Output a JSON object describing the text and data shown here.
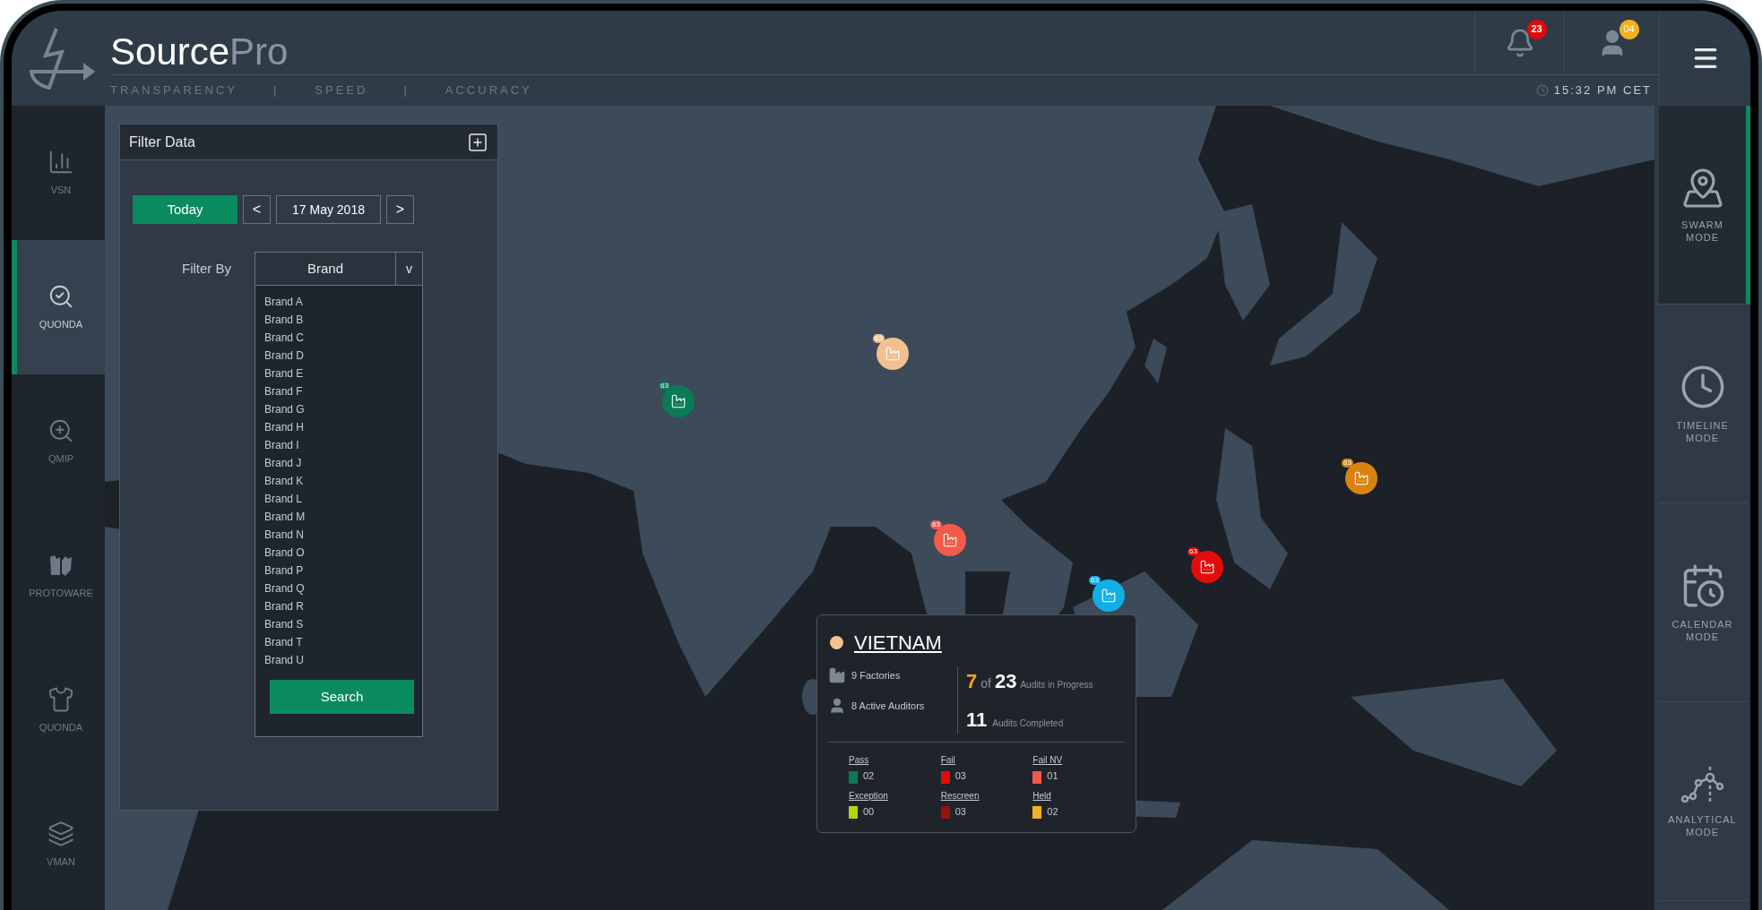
{
  "header": {
    "brand": "Source",
    "brand_suffix": "Pro",
    "tagline": [
      "TRANSPARENCY",
      "|",
      "SPEED",
      "|",
      "ACCURACY"
    ],
    "notifications_badge": "23",
    "users_badge": "04",
    "time": "15:32 PM CET"
  },
  "left_nav": [
    {
      "kind": "chart",
      "label": "VSN",
      "selected": false
    },
    {
      "kind": "search-check",
      "label": "QUONDA",
      "selected": true
    },
    {
      "kind": "zoom-in",
      "label": "QMIP",
      "selected": false
    },
    {
      "kind": "pieces",
      "label": "PROTOWARE",
      "selected": false
    },
    {
      "kind": "shirt",
      "label": "QUONDA",
      "selected": false
    },
    {
      "kind": "layers",
      "label": "VMAN",
      "selected": false
    }
  ],
  "right_nav": [
    {
      "kind": "map",
      "label": "SWARM MODE",
      "selected": true
    },
    {
      "kind": "clock",
      "label": "TIMELINE MODE",
      "selected": false
    },
    {
      "kind": "calendar",
      "label": "CALENDAR MODE",
      "selected": false
    },
    {
      "kind": "graph",
      "label": "ANALYTICAL MODE",
      "selected": false
    }
  ],
  "map_markers": [
    {
      "count": "63",
      "color": "#f0c08e"
    },
    {
      "count": "63",
      "color": "#0b7a55"
    },
    {
      "count": "63",
      "color": "#d9830f"
    },
    {
      "count": "63",
      "color": "#f25a4a"
    },
    {
      "count": "63",
      "color": "#e30c0c"
    },
    {
      "count": "63",
      "color": "#12aee6"
    }
  ],
  "filter_panel": {
    "title": "Filter Data",
    "today_button": "Today",
    "prev_button": "<",
    "date": "17 May 2018",
    "next_button": ">",
    "filter_label": "Filter By",
    "dropdown": {
      "value": "Brand",
      "caret": "v"
    },
    "brands": [
      "Brand A",
      "Brand B",
      "Brand C",
      "Brand D",
      "Brand E",
      "Brand F",
      "Brand G",
      "Brand H",
      "Brand I",
      "Brand J",
      "Brand K",
      "Brand L",
      "Brand M",
      "Brand N",
      "Brand O",
      "Brand P",
      "Brand Q",
      "Brand R",
      "Brand S",
      "Brand T",
      "Brand U"
    ],
    "search_button": "Search"
  },
  "tooltip": {
    "color": "#f2c38f",
    "title": "VIETNAM",
    "factories": "9 Factories",
    "auditors": "8 Active Auditors",
    "in_progress": {
      "count": "7",
      "of": "of",
      "total": "23",
      "label": "Audits in Progress"
    },
    "completed": {
      "count": "11",
      "label": "Audits Completed"
    },
    "statuses": [
      {
        "label": "Pass",
        "value": "02",
        "color": "#0b7a55"
      },
      {
        "label": "Fail",
        "value": "03",
        "color": "#e00b0b"
      },
      {
        "label": "Fail NV",
        "value": "01",
        "color": "#f2574a"
      },
      {
        "label": "Exception",
        "value": "00",
        "color": "#b5d40a"
      },
      {
        "label": "Rescreen",
        "value": "03",
        "color": "#9a0f12"
      },
      {
        "label": "Held",
        "value": "02",
        "color": "#f5b020"
      }
    ]
  }
}
